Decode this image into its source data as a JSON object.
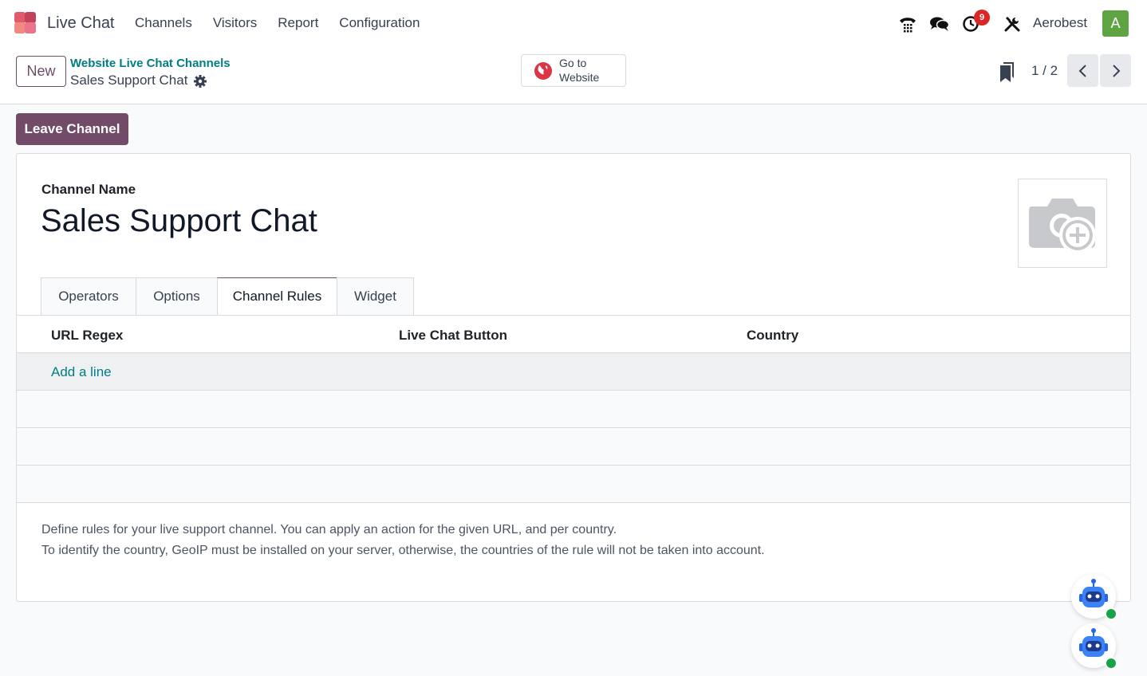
{
  "navbar": {
    "app_name": "Live Chat",
    "menu": [
      "Channels",
      "Visitors",
      "Report",
      "Configuration"
    ],
    "activity_count": "9",
    "company": "Aerobest",
    "avatar_initial": "A",
    "icons": [
      "phone-icon",
      "chat-bubbles-icon",
      "clock-icon",
      "tools-icon"
    ]
  },
  "control_panel": {
    "new_label": "New",
    "breadcrumb_parent": "Website Live Chat Channels",
    "breadcrumb_current": "Sales Support Chat",
    "goto_line1": "Go to",
    "goto_line2": "Website",
    "pager": "1 / 2"
  },
  "actions": {
    "leave_label": "Leave Channel"
  },
  "form": {
    "field_label": "Channel Name",
    "channel_name": "Sales Support Chat",
    "tabs": [
      "Operators",
      "Options",
      "Channel Rules",
      "Widget"
    ],
    "active_tab": "Channel Rules",
    "columns": [
      "URL Regex",
      "Live Chat Button",
      "Country"
    ],
    "add_line": "Add a line",
    "help_line1": "Define rules for your live support channel. You can apply an action for the given URL, and per country.",
    "help_line2": "To identify the country, GeoIP must be installed on your server, otherwise, the countries of the rule will not be taken into account."
  },
  "colors": {
    "brand": "#714b67",
    "link": "#017e84",
    "badge": "#dc2626",
    "avatar": "#5ea442",
    "online": "#16a34a"
  }
}
